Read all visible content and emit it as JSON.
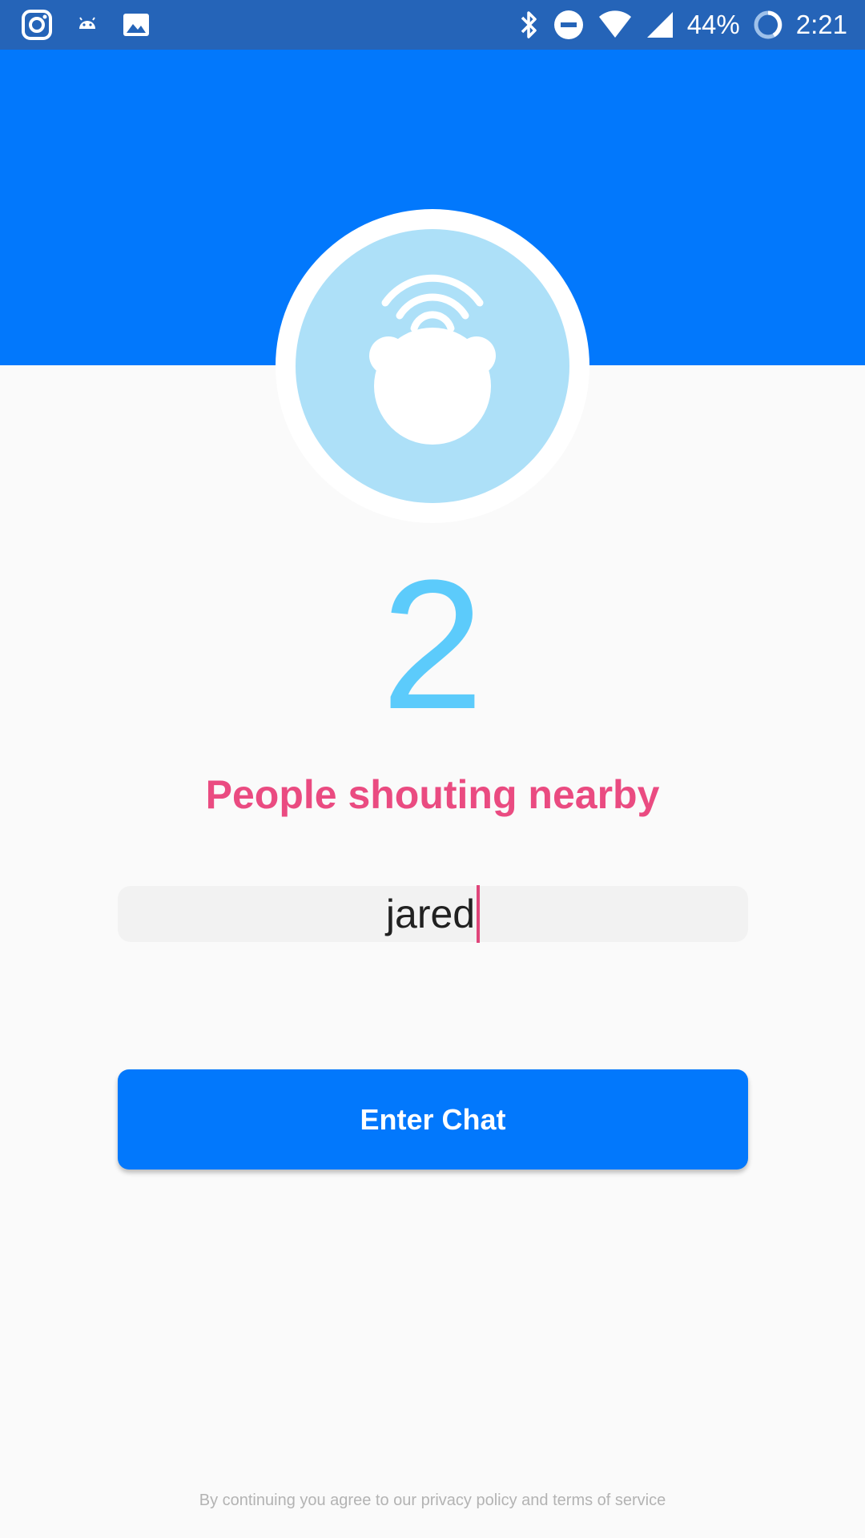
{
  "status_bar": {
    "left_icons": [
      "instagram-icon",
      "android-icon",
      "image-icon"
    ],
    "right_icons": [
      "bluetooth-icon",
      "do-not-disturb-icon",
      "wifi-icon",
      "signal-icon"
    ],
    "battery_percent": "44%",
    "time": "2:21"
  },
  "colors": {
    "status_bar": "#2564b8",
    "header": "#0278fc",
    "logo_fill": "#ade0f8",
    "count": "#5ccbfb",
    "subtitle": "#ea4b81",
    "button": "#0278fc"
  },
  "main": {
    "logo_icon": "bear-broadcast-icon",
    "count": "2",
    "subtitle": "People shouting nearby",
    "name_input_value": "jared",
    "enter_button_label": "Enter Chat",
    "footer_note": "By continuing you agree to our privacy policy and terms of service"
  }
}
